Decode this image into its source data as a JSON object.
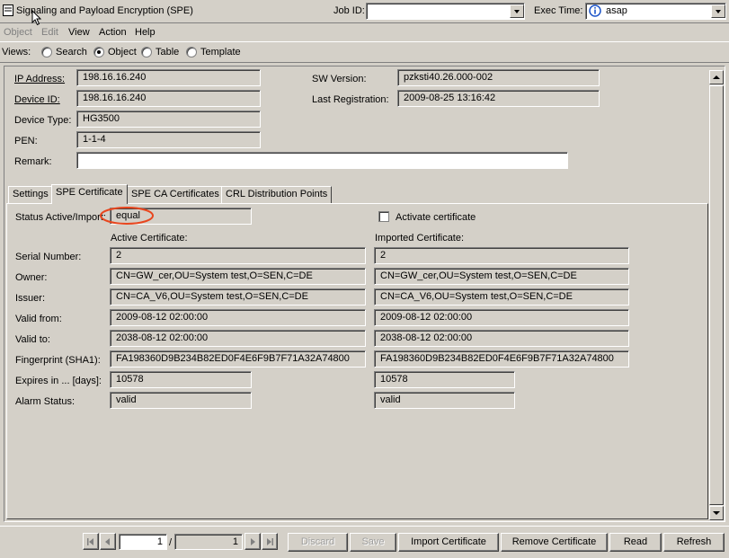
{
  "window": {
    "title": "Signaling and Payload Encryption (SPE)",
    "job_id_label": "Job ID:",
    "job_id_value": "",
    "exec_time_label": "Exec Time:",
    "exec_time_value": "asap"
  },
  "menu": {
    "items": [
      {
        "label": "Object",
        "enabled": false
      },
      {
        "label": "Edit",
        "enabled": false
      },
      {
        "label": "View",
        "enabled": true
      },
      {
        "label": "Action",
        "enabled": true
      },
      {
        "label": "Help",
        "enabled": true
      }
    ]
  },
  "views": {
    "label": "Views:",
    "options": [
      {
        "label": "Search",
        "selected": false
      },
      {
        "label": "Object",
        "selected": true
      },
      {
        "label": "Table",
        "selected": false
      },
      {
        "label": "Template",
        "selected": false
      }
    ]
  },
  "device": {
    "ip_label": "IP Address:",
    "ip_value": "198.16.16.240",
    "device_id_label": "Device ID:",
    "device_id_value": "198.16.16.240",
    "device_type_label": "Device Type:",
    "device_type_value": "HG3500",
    "pen_label": "PEN:",
    "pen_value": "1-1-4",
    "remark_label": "Remark:",
    "remark_value": "",
    "sw_version_label": "SW Version:",
    "sw_version_value": "pzksti40.26.000-002",
    "last_reg_label": "Last Registration:",
    "last_reg_value": "2009-08-25 13:16:42"
  },
  "tabs": [
    {
      "label": "Settings",
      "active": false
    },
    {
      "label": "SPE Certificate",
      "active": true
    },
    {
      "label": "SPE CA Certificates",
      "active": false
    },
    {
      "label": "CRL Distribution Points",
      "active": false
    }
  ],
  "cert": {
    "status_label": "Status Active/Import:",
    "status_value": "equal",
    "activate_label": "Activate certificate",
    "activate_checked": false,
    "active_header": "Active Certificate:",
    "imported_header": "Imported Certificate:",
    "rows": [
      {
        "label": "Serial Number:",
        "active": "2",
        "imported": "2"
      },
      {
        "label": "Owner:",
        "active": "CN=GW_cer,OU=System test,O=SEN,C=DE",
        "imported": "CN=GW_cer,OU=System test,O=SEN,C=DE"
      },
      {
        "label": "Issuer:",
        "active": "CN=CA_V6,OU=System test,O=SEN,C=DE",
        "imported": "CN=CA_V6,OU=System test,O=SEN,C=DE"
      },
      {
        "label": "Valid from:",
        "active": "2009-08-12 02:00:00",
        "imported": "2009-08-12 02:00:00"
      },
      {
        "label": "Valid to:",
        "active": "2038-08-12 02:00:00",
        "imported": "2038-08-12 02:00:00"
      },
      {
        "label": "Fingerprint (SHA1):",
        "active": "FA198360D9B234B82ED0F4E6F9B7F71A32A74800",
        "imported": "FA198360D9B234B82ED0F4E6F9B7F71A32A74800"
      },
      {
        "label": "Expires in ... [days]:",
        "active": "10578",
        "imported": "10578"
      },
      {
        "label": "Alarm Status:",
        "active": "valid",
        "imported": "valid"
      }
    ]
  },
  "footer": {
    "page_current": "1",
    "page_separator": "/",
    "page_total": "1",
    "buttons": [
      {
        "label": "Discard",
        "enabled": false
      },
      {
        "label": "Save",
        "enabled": false
      },
      {
        "label": "Import Certificate",
        "enabled": true
      },
      {
        "label": "Remove Certificate",
        "enabled": true
      },
      {
        "label": "Read",
        "enabled": true
      },
      {
        "label": "Refresh",
        "enabled": true
      }
    ]
  },
  "colors": {
    "window_bg": "#d4d0c8",
    "highlight_ellipse": "#e8461e",
    "info_icon": "#1c54c8"
  }
}
